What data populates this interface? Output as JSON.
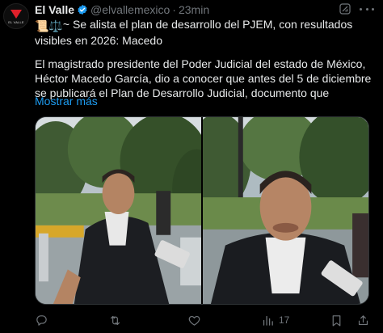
{
  "tweet": {
    "author_name": "El Valle",
    "handle": "@elvallemexico",
    "separator": "·",
    "time": "23min",
    "avatar_logo_text": "EL VALLE",
    "text_line1": "~ Se alista el plan de desarrollo del PJEM, con resultados visibles en 2026: Macedo",
    "text_line2": "El magistrado presidente del Poder Judicial del estado de México, Héctor Macedo García, dio a conocer que antes del 5 de diciembre se publicará el Plan de Desarrollo Judicial, documento que",
    "emoji_prefix": "📜⚖️",
    "show_more": "Mostrar más",
    "views_count": "17",
    "colors": {
      "link": "#1d9bf0",
      "muted": "#71767b",
      "verified": "#1d9bf0",
      "background": "#000000"
    },
    "icons": [
      "verified-badge-icon",
      "grok-icon",
      "more-icon",
      "reply-icon",
      "retweet-icon",
      "like-icon",
      "views-icon",
      "bookmark-icon",
      "share-icon"
    ]
  }
}
